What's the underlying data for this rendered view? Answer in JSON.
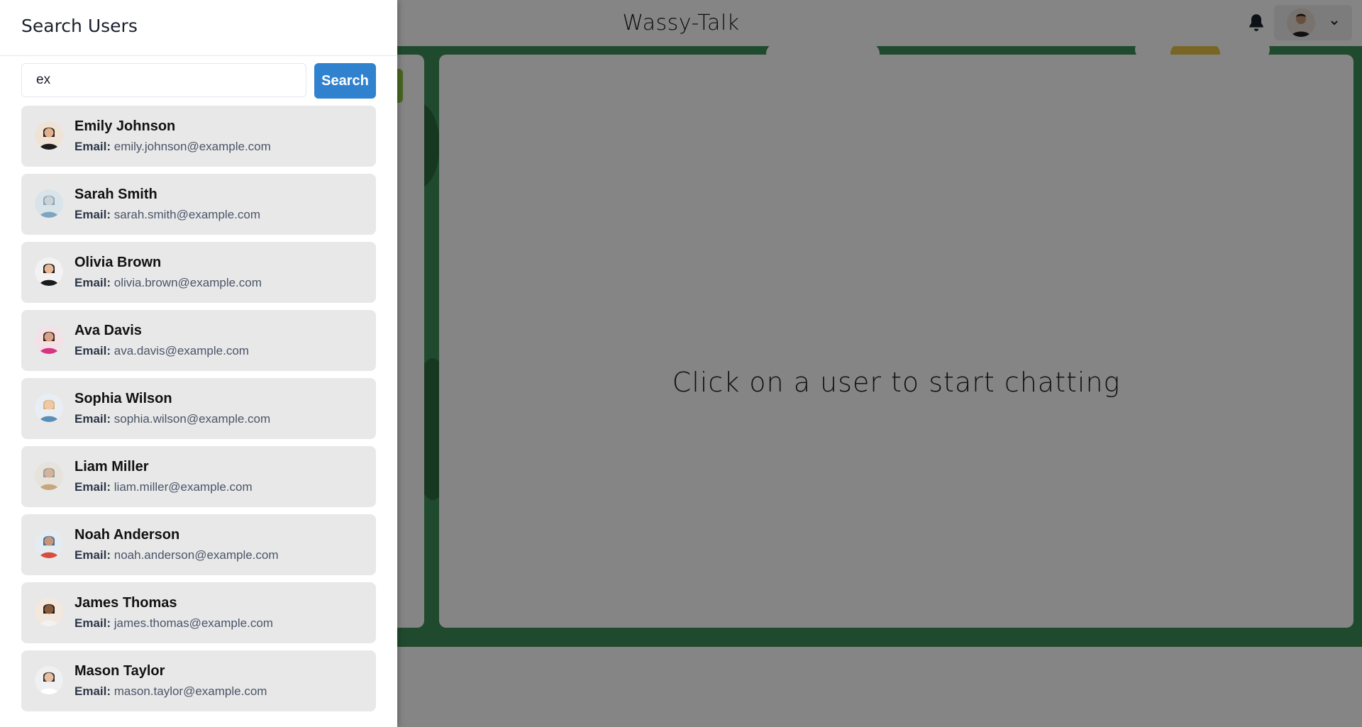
{
  "app": {
    "title": "Wassy-Talk",
    "chat_placeholder": "Click on a user to start chatting"
  },
  "drawer": {
    "title": "Search Users",
    "search": {
      "value": "ex",
      "placeholder": "Search by name or email"
    },
    "search_button": "Search",
    "email_label": "Email:"
  },
  "users": [
    {
      "name": "Emily Johnson",
      "email": "emily.johnson@example.com"
    },
    {
      "name": "Sarah Smith",
      "email": "sarah.smith@example.com"
    },
    {
      "name": "Olivia Brown",
      "email": "olivia.brown@example.com"
    },
    {
      "name": "Ava Davis",
      "email": "ava.davis@example.com"
    },
    {
      "name": "Sophia Wilson",
      "email": "sophia.wilson@example.com"
    },
    {
      "name": "Liam Miller",
      "email": "liam.miller@example.com"
    },
    {
      "name": "Noah Anderson",
      "email": "noah.anderson@example.com"
    },
    {
      "name": "James Thomas",
      "email": "james.thomas@example.com"
    },
    {
      "name": "Mason Taylor",
      "email": "mason.taylor@example.com"
    }
  ],
  "colors": {
    "accent": "#3182ce",
    "card_bg": "#e8e8e8",
    "wallpaper": "#3f8f57"
  }
}
